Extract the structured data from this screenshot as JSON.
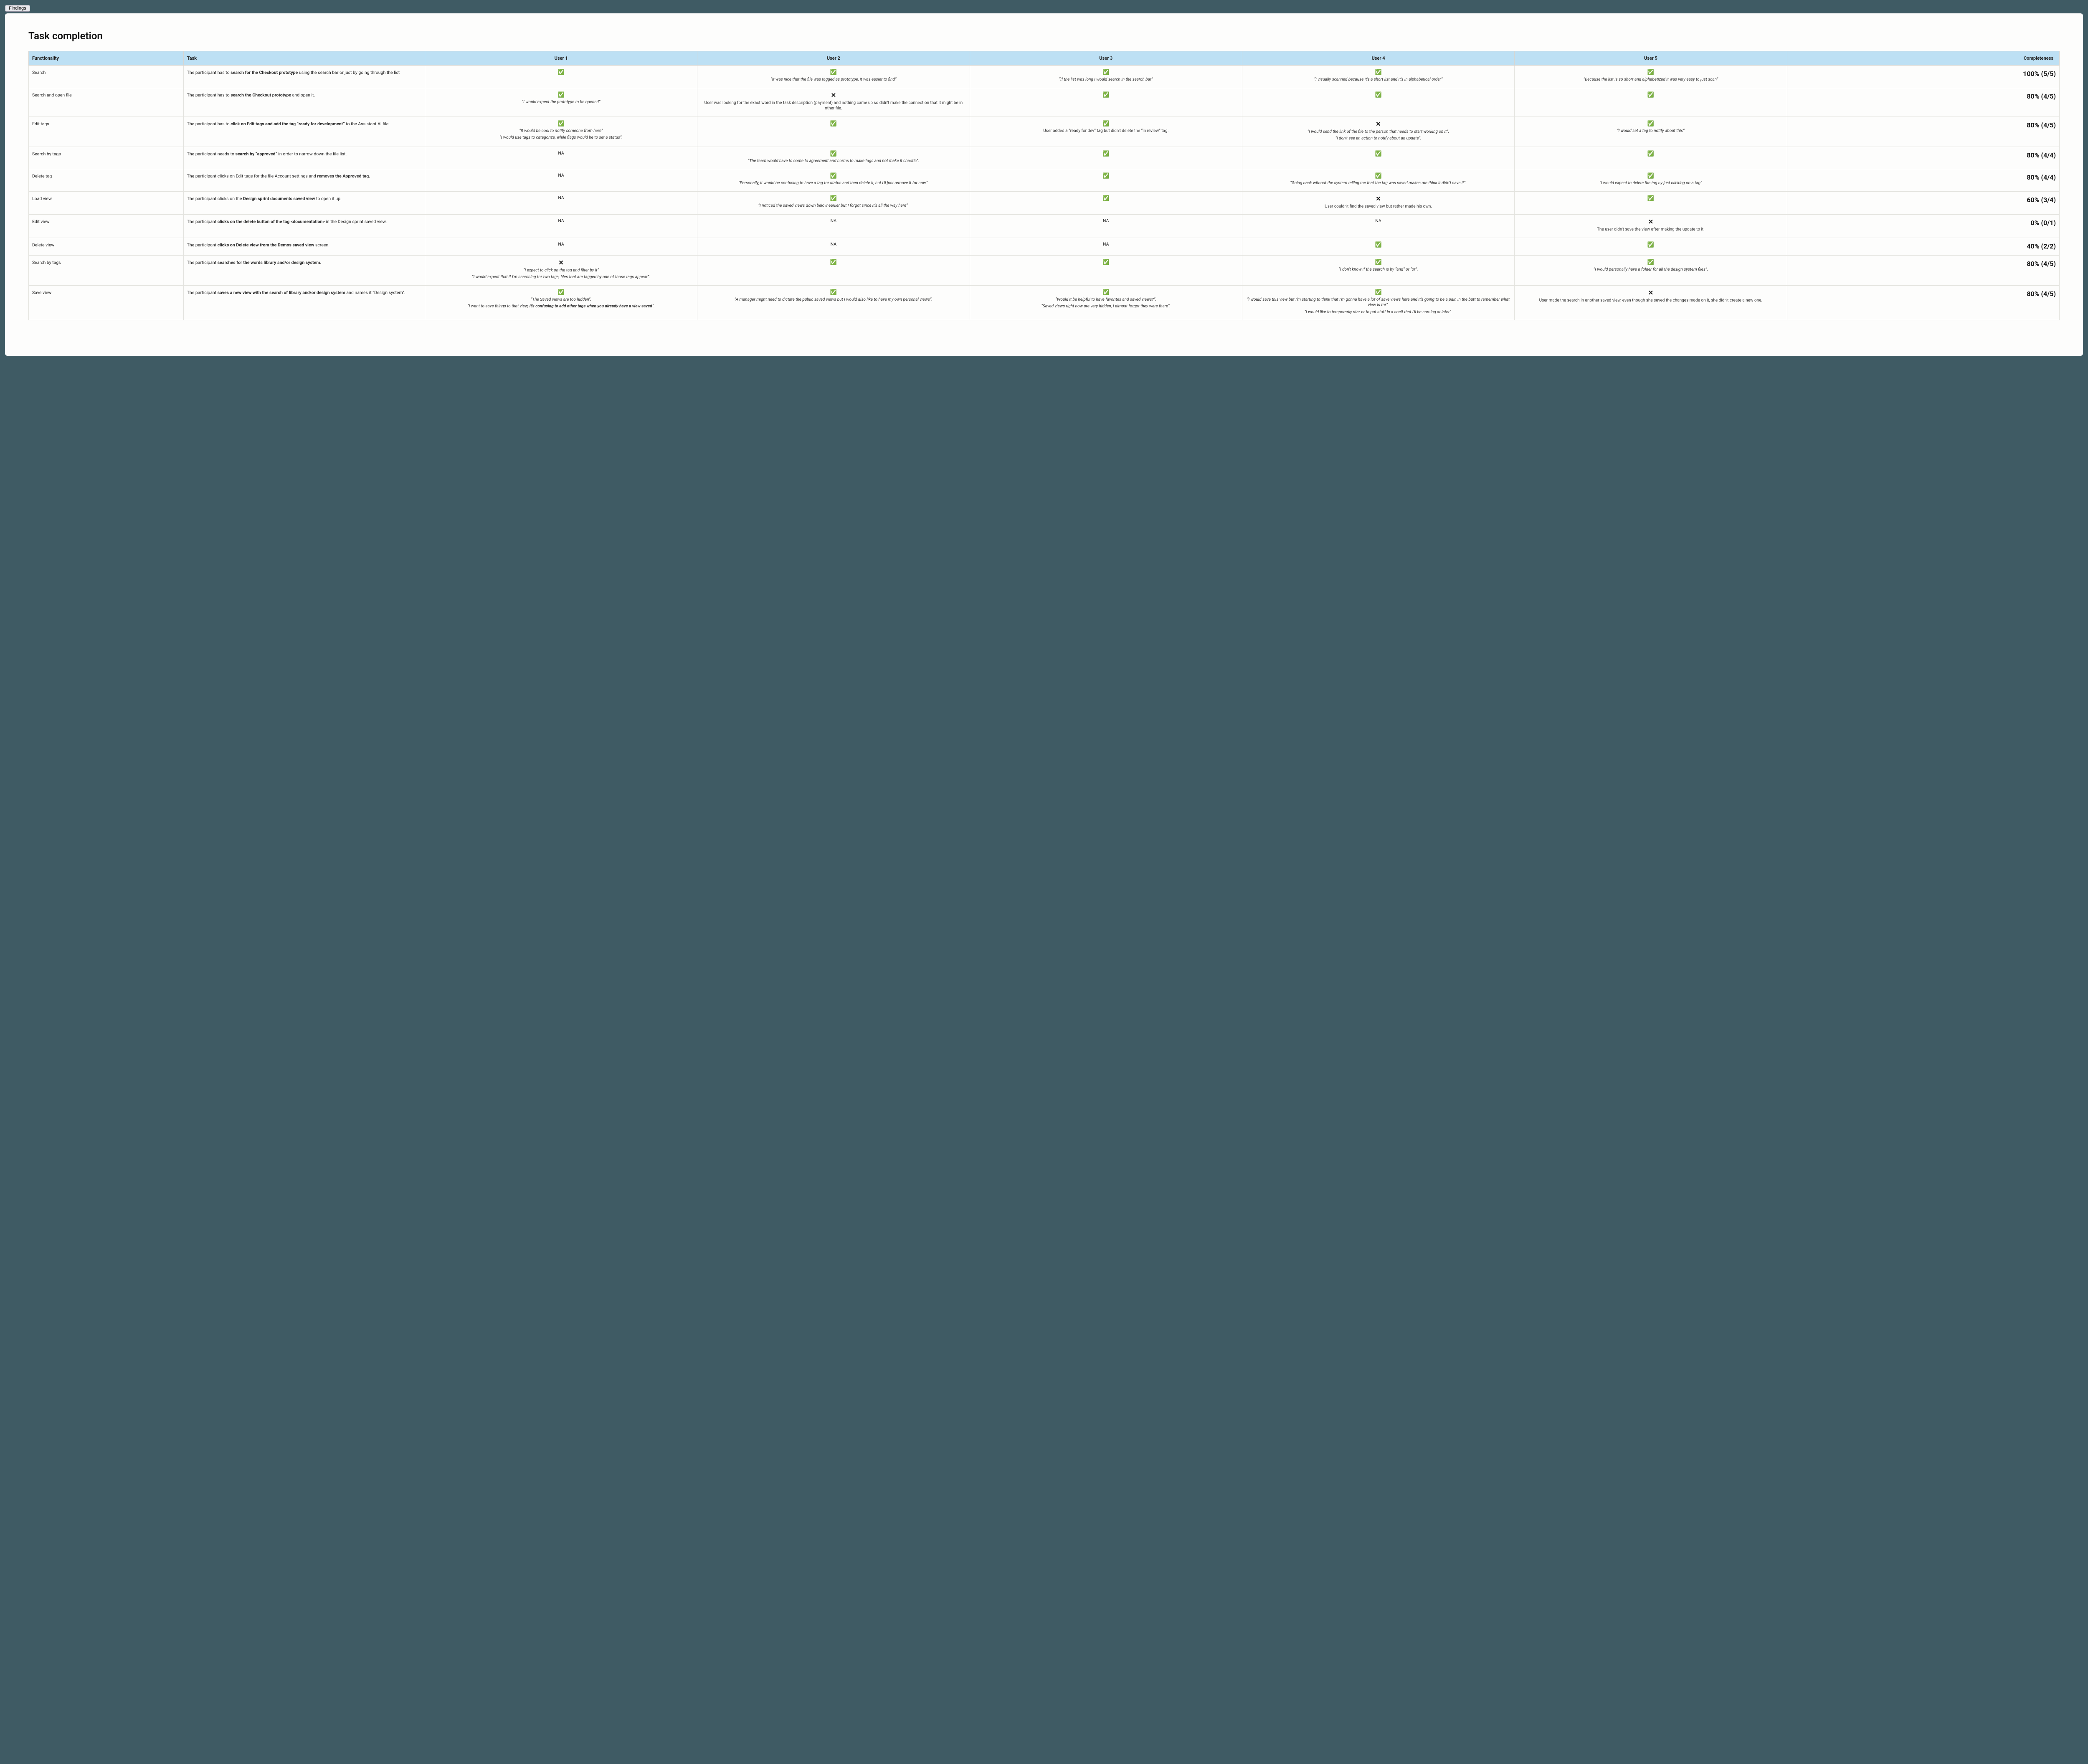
{
  "tab": "Findings",
  "title": "Task completion",
  "headers": {
    "functionality": "Functionality",
    "task": "Task",
    "user1": "User 1",
    "user2": "User 2",
    "user3": "User 3",
    "user4": "User 4",
    "user5": "User 5",
    "completeness": "Completeness"
  },
  "rows": [
    {
      "functionality": "Search",
      "task_html": "The participant has to <b>search for the Checkout prototype</b> using the search bar or just by going through the list",
      "cells": [
        {
          "status": "pass",
          "notes": []
        },
        {
          "status": "pass",
          "notes": [
            {
              "text": "“It was nice that the file was tagged as prototype, it was easier to find”",
              "italic": true
            }
          ]
        },
        {
          "status": "pass",
          "notes": [
            {
              "text": "“If the list was long I would search in the search bar”",
              "italic": true
            }
          ]
        },
        {
          "status": "pass",
          "notes": [
            {
              "text": "“I visually scanned because it's a short list and it's in alphabetical order”",
              "italic": true
            }
          ]
        },
        {
          "status": "pass",
          "notes": [
            {
              "text": "“Because the list is so short and alphabetized it was very easy to just scan”",
              "italic": true
            }
          ]
        }
      ],
      "completeness": "100% (5/5)"
    },
    {
      "functionality": "Search and open file",
      "task_html": "The participant has to <b>search the Checkout prototype</b> and open it.",
      "cells": [
        {
          "status": "pass",
          "notes": [
            {
              "text": "“I would expect the prototype to be opened”",
              "italic": true
            }
          ]
        },
        {
          "status": "fail",
          "notes": [
            {
              "text": "User was looking for the exact word in the task description (payment) and nothing came up so didn't make the connection that it might be in other file.",
              "italic": false
            }
          ]
        },
        {
          "status": "pass",
          "notes": []
        },
        {
          "status": "pass",
          "notes": []
        },
        {
          "status": "pass",
          "notes": []
        }
      ],
      "completeness": "80% (4/5)"
    },
    {
      "functionality": "Edit tags",
      "task_html": "The participant has to <b>click on Edit tags and add the tag “ready for development”</b> to the Assistant AI file.",
      "cells": [
        {
          "status": "pass",
          "notes": [
            {
              "text": "“It would be cool to notify someone from here”",
              "italic": true
            },
            {
              "text": "“I would use tags to categorize, while flags would be to set a status”.",
              "italic": true
            }
          ]
        },
        {
          "status": "pass",
          "notes": []
        },
        {
          "status": "pass",
          "notes": [
            {
              "text": "User added a “ready for dev” tag but didn't delete the “in review” tag.",
              "italic": false
            }
          ]
        },
        {
          "status": "fail",
          "notes": [
            {
              "text": "“I would send the link of the file to the person that needs to start working on it”.",
              "italic": true
            },
            {
              "text": "“I don't see an action to notify about an update”.",
              "italic": true
            }
          ]
        },
        {
          "status": "pass",
          "notes": [
            {
              "text": "“I would set a tag to notify about this”",
              "italic": true
            }
          ]
        }
      ],
      "completeness": "80% (4/5)"
    },
    {
      "functionality": "Search by tags",
      "task_html": "The participant needs to <b>search by “approved”</b> in order to narrow down the file list.",
      "cells": [
        {
          "status": "na",
          "notes": []
        },
        {
          "status": "pass",
          "notes": [
            {
              "text": "“The team would have to come to agreement and norms to make tags and not make it chaotic”.",
              "italic": true
            }
          ]
        },
        {
          "status": "pass",
          "notes": []
        },
        {
          "status": "pass",
          "notes": []
        },
        {
          "status": "pass",
          "notes": []
        }
      ],
      "completeness": "80% (4/4)"
    },
    {
      "functionality": "Delete tag",
      "task_html": "The participant clicks on Edit tags for the file Account settings and <b>removes the Approved tag.</b>",
      "cells": [
        {
          "status": "na",
          "notes": []
        },
        {
          "status": "pass",
          "notes": [
            {
              "text": "“Personally, it would be confusing to have a tag for status and then delete it, but I'll just remove it for now”.",
              "italic": true
            }
          ]
        },
        {
          "status": "pass",
          "notes": []
        },
        {
          "status": "pass",
          "notes": [
            {
              "text": "“Going back without the system telling me that the tag was saved makes me think it didn't save it”.",
              "italic": true
            }
          ]
        },
        {
          "status": "pass",
          "notes": [
            {
              "text": "“I would expect to delete the tag by just clicking on a tag”",
              "italic": true
            }
          ]
        }
      ],
      "completeness": "80% (4/4)"
    },
    {
      "functionality": "Load view",
      "task_html": "The participant clicks on the <b>Design sprint documents saved view</b> to open it up.",
      "cells": [
        {
          "status": "na",
          "notes": []
        },
        {
          "status": "pass",
          "notes": [
            {
              "text": "“I noticed the saved views down below earlier but I forgot since it's all the way here”.",
              "italic": true
            }
          ]
        },
        {
          "status": "pass",
          "notes": []
        },
        {
          "status": "fail",
          "notes": [
            {
              "text": "User couldn't find the saved view but rather made his own.",
              "italic": false
            }
          ]
        },
        {
          "status": "pass",
          "notes": []
        }
      ],
      "completeness": "60% (3/4)"
    },
    {
      "functionality": "Edit view",
      "task_html": "The participant <b>clicks on the delete button of the tag &lt;documentation&gt;</b> in the Design sprint saved view.",
      "cells": [
        {
          "status": "na",
          "notes": []
        },
        {
          "status": "na",
          "notes": []
        },
        {
          "status": "na",
          "notes": []
        },
        {
          "status": "na",
          "notes": []
        },
        {
          "status": "fail",
          "notes": [
            {
              "text": "The user didn't save the view after making the update to it.",
              "italic": false
            }
          ]
        }
      ],
      "completeness": "0% (0/1)"
    },
    {
      "functionality": "Delete view",
      "task_html": "The participant <b>clicks on Delete view from the Demos saved view</b> screen.",
      "cells": [
        {
          "status": "na",
          "notes": []
        },
        {
          "status": "na",
          "notes": []
        },
        {
          "status": "na",
          "notes": []
        },
        {
          "status": "pass",
          "notes": []
        },
        {
          "status": "pass",
          "notes": []
        }
      ],
      "completeness": "40% (2/2)"
    },
    {
      "functionality": "Search by tags",
      "task_html": "The participant <b>searches for the words library and/or design system.</b>",
      "cells": [
        {
          "status": "fail",
          "notes": [
            {
              "text": "“I expect to click on the tag and filter by it”",
              "italic": true
            },
            {
              "text": "“I would expect that if I'm searching for two tags, files that are tagged by one of those tags appear”.",
              "italic": true
            }
          ]
        },
        {
          "status": "pass",
          "notes": []
        },
        {
          "status": "pass",
          "notes": []
        },
        {
          "status": "pass",
          "notes": [
            {
              "text": "“I don't know if the search is by “and” or “or”.",
              "italic": true
            }
          ]
        },
        {
          "status": "pass",
          "notes": [
            {
              "text": "“I would personally have a folder for all the design system files”.",
              "italic": true
            }
          ]
        }
      ],
      "completeness": "80% (4/5)"
    },
    {
      "functionality": "Save view",
      "task_html": "The participant <b>saves a new view with the search of library and/or design system</b> and names it “Design system”.",
      "cells": [
        {
          "status": "pass",
          "notes": [
            {
              "text": "“The Saved views are too hidden”.",
              "italic": true
            },
            {
              "text": "“I want to save things to that view, <b>it's confusing to add other tags when you already have a view saved</b>”.",
              "italic": true
            }
          ]
        },
        {
          "status": "pass",
          "notes": [
            {
              "text": "“A manager might need to dictate the public saved views but I would also like to have my own personal views”.",
              "italic": true
            }
          ]
        },
        {
          "status": "pass",
          "notes": [
            {
              "text": "“Would it be helpful to have favorites and saved views?”.",
              "italic": true
            },
            {
              "text": "“Saved views right now are very hidden, I almost forgot they were there”.",
              "italic": true
            }
          ]
        },
        {
          "status": "pass",
          "notes": [
            {
              "text": "“I would save this view but I'm starting to think that I'm gonna have a lot of save views here and it's going to be a pain in the butt to remember what view is for”.",
              "italic": true
            },
            {
              "text": "“I would like to temporarily star or to put stuff in a shelf that I'll be coming at later”.",
              "italic": true
            }
          ]
        },
        {
          "status": "fail",
          "notes": [
            {
              "text": "User made the search in another saved view, even though she saved the changes made on it, she didn't create a new one.",
              "italic": false
            }
          ]
        }
      ],
      "completeness": "80% (4/5)"
    }
  ]
}
